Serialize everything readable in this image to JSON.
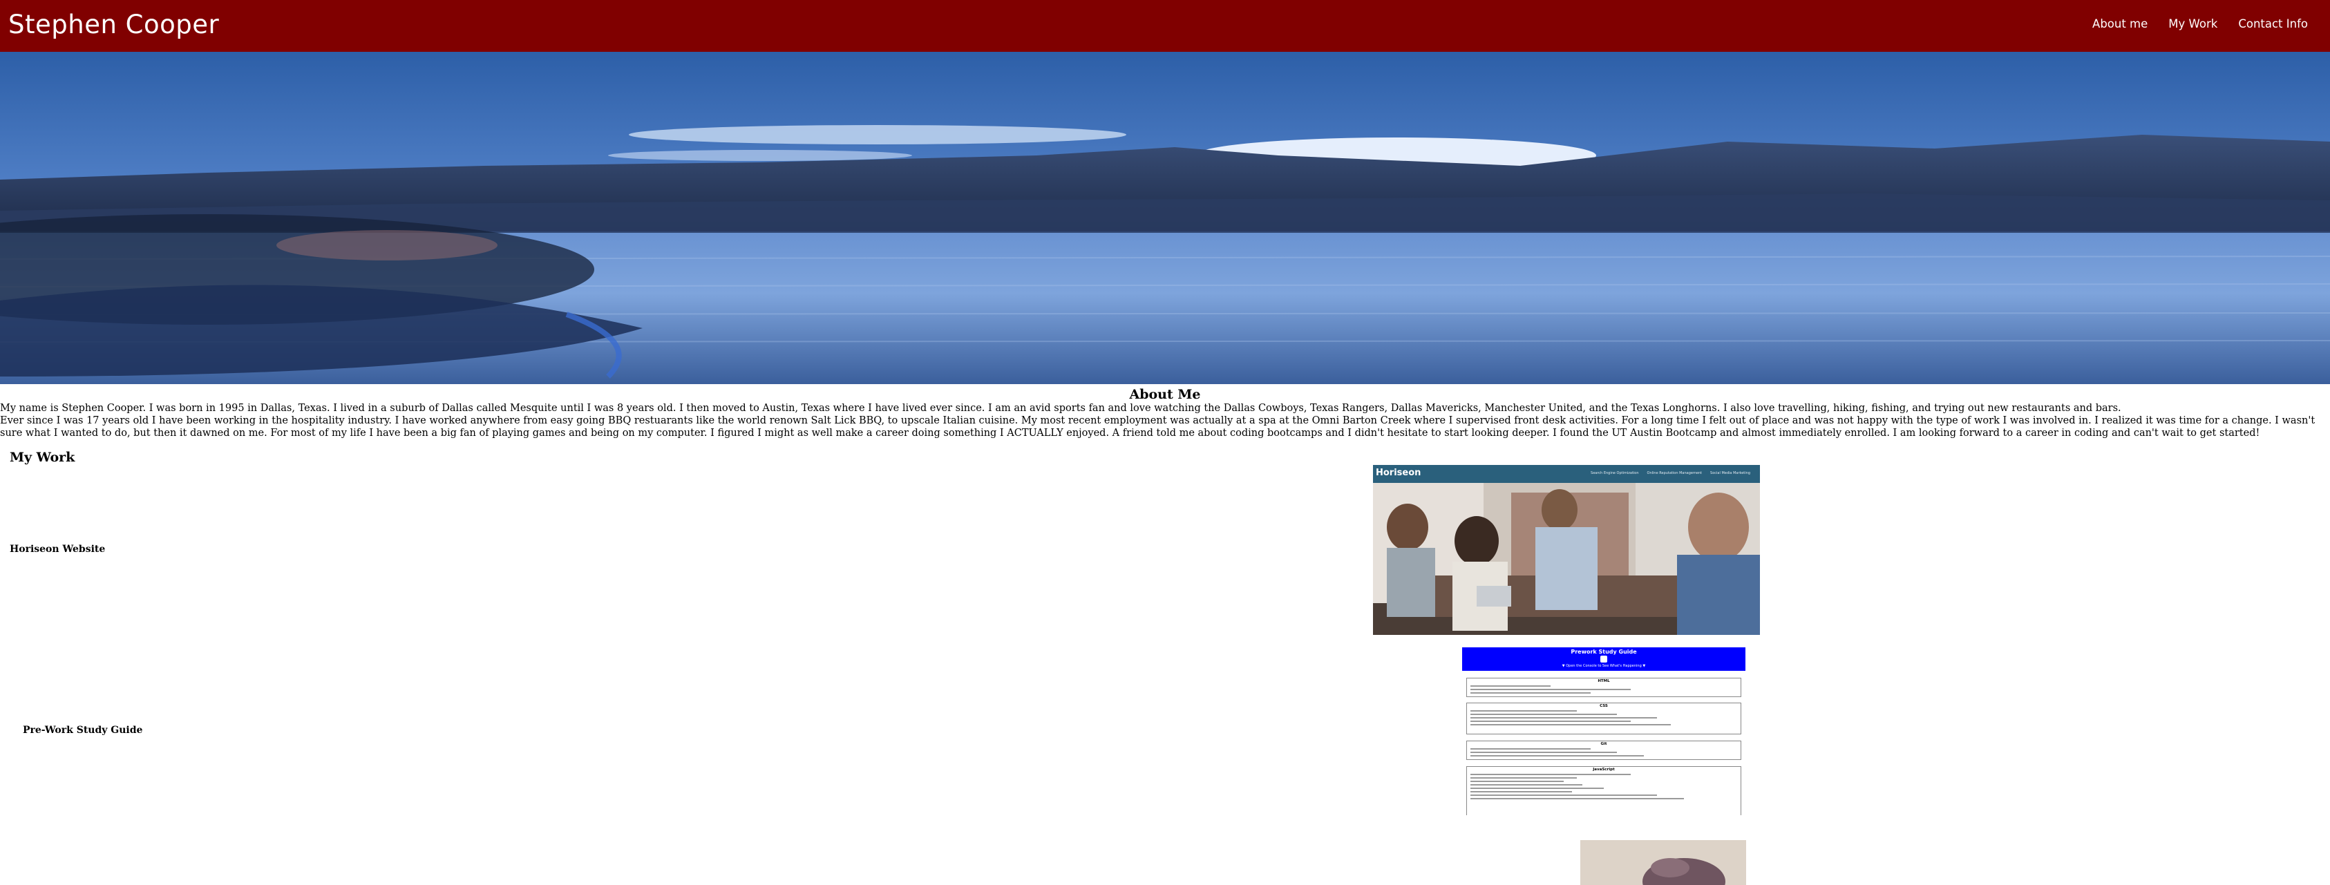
{
  "header": {
    "brand": "Stephen Cooper",
    "nav": [
      "About me",
      "My Work",
      "Contact Info"
    ]
  },
  "hero": {
    "image": "lake-landscape-panorama"
  },
  "about": {
    "title": "About Me",
    "paragraphs": [
      "My name is Stephen Cooper. I was born in 1995 in Dallas, Texas. I lived in a suburb of Dallas called Mesquite until I was 8 years old. I then moved to Austin, Texas where I have lived ever since. I am an avid sports fan and love watching the Dallas Cowboys, Texas Rangers, Dallas Mavericks, Manchester United, and the Texas Longhorns. I also love travelling, hiking, fishing, and trying out new restaurants and bars.",
      "Ever since I was 17 years old I have been working in the hospitality industry. I have worked anywhere from easy going BBQ restuarants like the world renown Salt Lick BBQ, to upscale Italian cuisine. My most recent employment was actually at a spa at the Omni Barton Creek where I supervised front desk activities. For a long time I felt out of place and was not happy with the type of work I was involved in. I realized it was time for a change. I wasn't sure what I wanted to do, but then it dawned on me. For most of my life I have been a big fan of playing games and being on my computer. I figured I might as well make a career doing something I ACTUALLY enjoyed. A friend told me about coding bootcamps and I didn't hesitate to start looking deeper. I found the UT Austin Bootcamp and almost immediately enrolled. I am looking forward to a career in coding and can't wait to get started!"
    ]
  },
  "work": {
    "title": "My Work",
    "projects": [
      {
        "label": "Horiseon Website",
        "thumbnail": {
          "logo": "Horiseon",
          "nav": [
            "Search Engine Optimization",
            "Online Reputation Management",
            "Social Media Marketing"
          ]
        }
      },
      {
        "label": "Pre-Work Study Guide",
        "thumbnail": {
          "title": "Prework Study Guide",
          "subtitle": "▼ Open the Console to See What's Happening ▼",
          "sections": [
            "HTML",
            "CSS",
            "Git",
            "JavaScript"
          ]
        }
      }
    ]
  },
  "colors": {
    "header_bg": "#800000",
    "study_guide_header": "#0000ff",
    "horiseon_header": "#2a607c"
  }
}
